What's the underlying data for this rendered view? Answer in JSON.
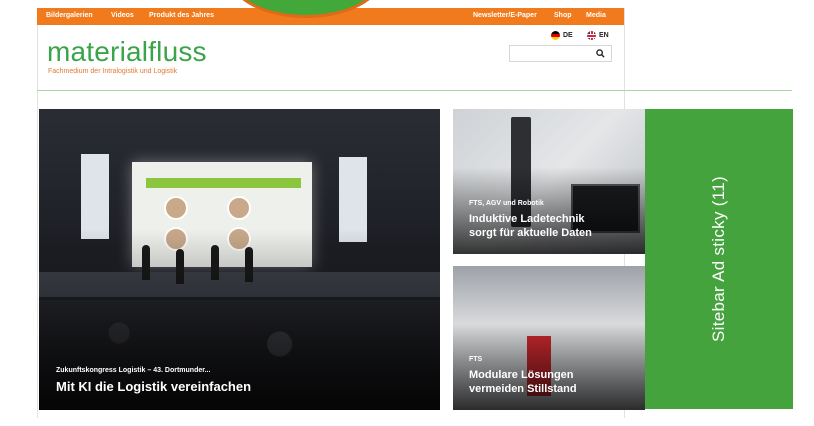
{
  "topnav": {
    "left": [
      "Bildergalerien",
      "Videos",
      "Produkt des Jahres"
    ],
    "right": [
      "Newsletter/E-Paper",
      "Shop",
      "Media"
    ]
  },
  "brand": {
    "name": "materialfluss",
    "tagline": "Fachmedium der Intralogistik und Logistik"
  },
  "languages": [
    {
      "code": "DE"
    },
    {
      "code": "EN"
    }
  ],
  "search": {
    "placeholder": ""
  },
  "articles": {
    "main": {
      "kicker": "Zukunftskongress Logistik – 43. Dortmunder...",
      "title": "Mit KI die Logistik vereinfachen"
    },
    "second": {
      "kicker": "FTS, AGV und Robotik",
      "title_line1": "Induktive Ladetechnik",
      "title_line2": "sorgt für aktuelle Daten"
    },
    "third": {
      "kicker": "FTS",
      "title_line1": "Modulare Lösungen",
      "title_line2": "vermeiden Stillstand"
    }
  },
  "ad": {
    "label": "Sitebar Ad sticky (11)"
  },
  "colors": {
    "accent_orange": "#f07a1c",
    "brand_green": "#3aa44a",
    "ad_green": "#44a33d"
  }
}
